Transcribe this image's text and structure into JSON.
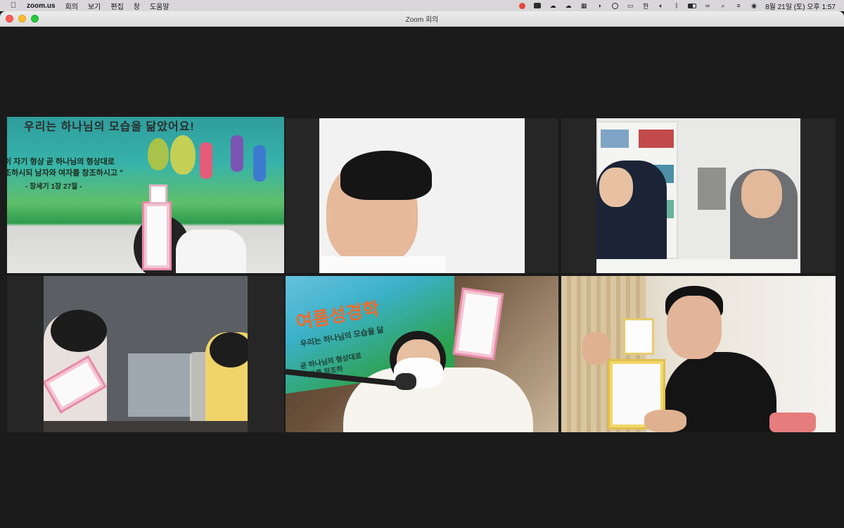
{
  "menubar": {
    "app_name": "zoom.us",
    "menus": [
      "회의",
      "보기",
      "편집",
      "창",
      "도움말"
    ],
    "clock": "8월 21일 (토) 오후 1:57",
    "status_icons": [
      "screen-record-icon",
      "zoom-icon",
      "cloud-icon",
      "cloud-icon",
      "control-grid-icon",
      "half-circle-icon",
      "play-icon",
      "window-icon",
      "keyboard-icon",
      "volume-icon",
      "bluetooth-icon",
      "battery-icon",
      "link-icon",
      "search-icon",
      "control-center-icon",
      "siri-icon"
    ]
  },
  "window": {
    "title": "Zoom 회의"
  },
  "tiles": {
    "t1": {
      "banner_header": "우리는 하나님의 모습을 닮았어요!",
      "verse_line1": "이 자기 형상 곧 하나님의 형상대로",
      "verse_line2": "조하시되 남자와 여자를 창조하시고 \"",
      "verse_ref": "- 창세기 1장 27절 -"
    },
    "t5": {
      "banner_word": "여름성경학",
      "banner_sub": "우리는 하나님의 모습을 닮",
      "banner_line1": "곧 하나님의 형상대로",
      "banner_line2": "여자를 창조하"
    }
  },
  "colors": {
    "active_border": "#d4e14a",
    "background": "#1b1b1b"
  }
}
